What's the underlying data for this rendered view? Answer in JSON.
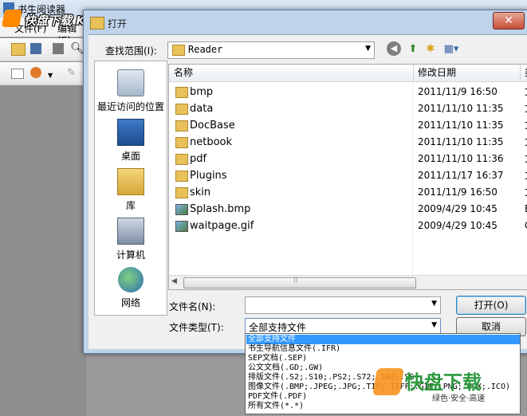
{
  "background_app": {
    "title": "书生阅读器",
    "menu": [
      "文件(F)",
      "编辑(E)"
    ]
  },
  "watermark": {
    "text": "快盘下载 KKPAN.COM",
    "brand": "快盘下载",
    "slogan": "绿色·安全·高速"
  },
  "dialog": {
    "title": "打开",
    "look_in_label": "查找范围(I):",
    "look_in_value": "Reader",
    "places": [
      "最近访问的位置",
      "桌面",
      "库",
      "计算机",
      "网络"
    ],
    "columns": [
      "名称",
      "修改日期",
      "类"
    ],
    "files": [
      {
        "name": "bmp",
        "date": "2011/11/9 16:50",
        "type": "文",
        "kind": "folder"
      },
      {
        "name": "data",
        "date": "2011/11/10 11:35",
        "type": "文",
        "kind": "folder"
      },
      {
        "name": "DocBase",
        "date": "2011/11/10 11:35",
        "type": "文",
        "kind": "folder"
      },
      {
        "name": "netbook",
        "date": "2011/11/10 11:35",
        "type": "文",
        "kind": "folder"
      },
      {
        "name": "pdf",
        "date": "2011/11/10 11:36",
        "type": "文",
        "kind": "folder"
      },
      {
        "name": "Plugins",
        "date": "2011/11/17 16:37",
        "type": "文",
        "kind": "folder"
      },
      {
        "name": "skin",
        "date": "2011/11/9 16:50",
        "type": "文",
        "kind": "folder"
      },
      {
        "name": "Splash.bmp",
        "date": "2009/4/29 10:45",
        "type": "B",
        "kind": "image"
      },
      {
        "name": "waitpage.gif",
        "date": "2009/4/29 10:45",
        "type": "G",
        "kind": "image"
      }
    ],
    "filename_label": "文件名(N):",
    "filename_value": "",
    "filetype_label": "文件类型(T):",
    "filetype_value": "全部支持文件",
    "open_button": "打开(O)",
    "cancel_button": "取消",
    "filetype_options": [
      "全部支持文件",
      "书生导航信息文件(.IFR)",
      "SEP文档(.SEP)",
      "公文文档(.GD;.GW)",
      "排版文件(.S2;.S10;.PS2;.S72;.S92;.SS",
      "图像文件(.BMP;.JPEG;.JPG;.TIF;.TIFF;.GIF;.PNG;.PCX;.ICO)",
      "PDF文件(.PDF)",
      "所有文件(*.*)"
    ],
    "selected_option_index": 0
  },
  "colors": {
    "accent": "#3399ff",
    "folder": "#e8c15a"
  }
}
